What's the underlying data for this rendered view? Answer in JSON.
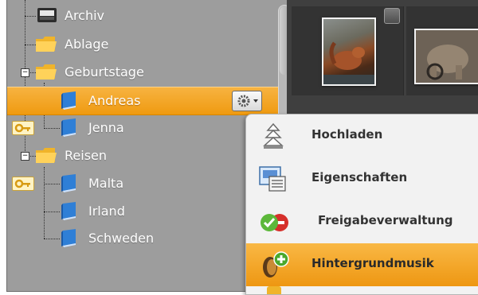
{
  "tree": {
    "items": [
      {
        "label": "Archiv",
        "icon": "archive-icon"
      },
      {
        "label": "Ablage",
        "icon": "folder-icon"
      },
      {
        "label": "Geburtstage",
        "icon": "folder-icon",
        "expander": "−"
      },
      {
        "label": "Andreas",
        "icon": "book-icon",
        "selected": true
      },
      {
        "label": "Jenna",
        "icon": "book-icon",
        "locked": true
      },
      {
        "label": "Reisen",
        "icon": "folder-icon",
        "expander": "−"
      },
      {
        "label": "Malta",
        "icon": "book-icon",
        "locked": true
      },
      {
        "label": "Irland",
        "icon": "book-icon"
      },
      {
        "label": "Schweden",
        "icon": "book-icon"
      }
    ]
  },
  "menu": {
    "items": [
      {
        "label": "Hochladen",
        "icon": "upload-tower-icon"
      },
      {
        "label": "Eigenschaften",
        "icon": "properties-icon"
      },
      {
        "label": "Freigabeverwaltung",
        "icon": "share-management-icon"
      },
      {
        "label": "Hintergrundmusik",
        "icon": "background-music-icon",
        "highlighted": true
      }
    ]
  },
  "colors": {
    "selection": "#f3a728",
    "tree_bg": "#9d9d9d",
    "gallery_bg": "#3f3f3f",
    "menu_bg": "#f2f2f2"
  }
}
